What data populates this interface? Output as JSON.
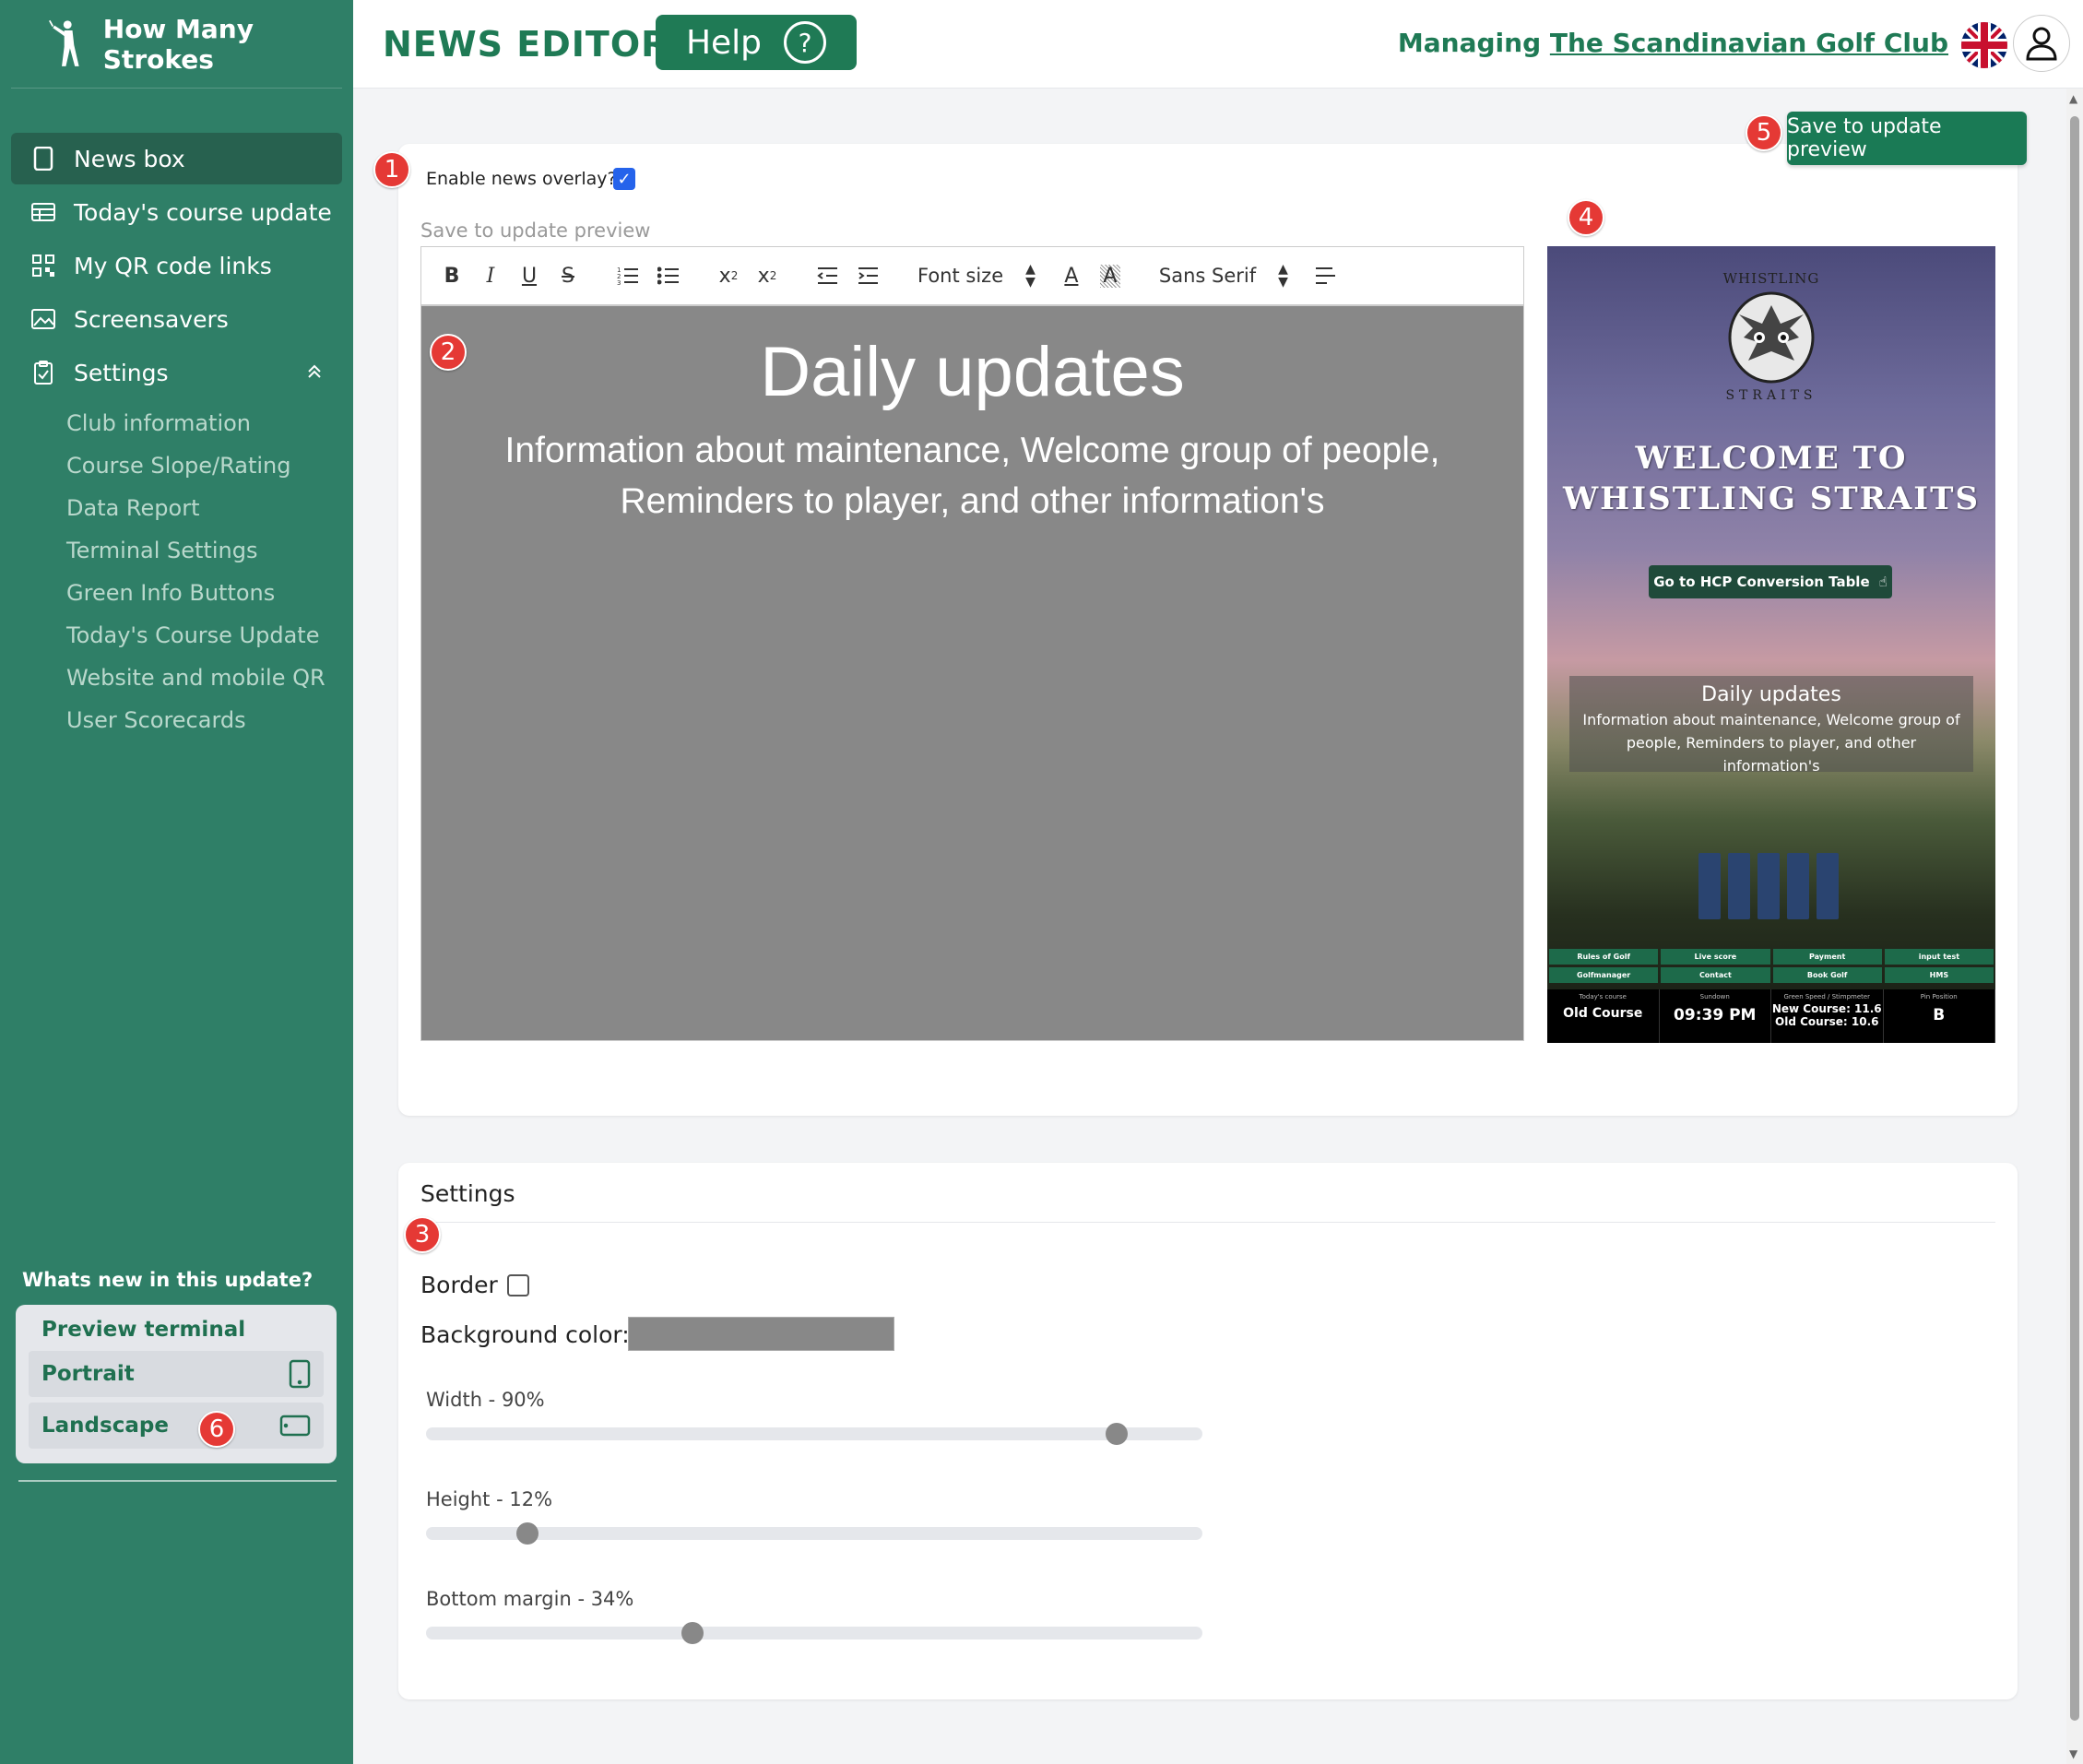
{
  "brand": {
    "name": "How Many Strokes"
  },
  "header": {
    "title": "NEWS EDITOR",
    "help_label": "Help",
    "managing_prefix": "Managing",
    "club_name": "The Scandinavian Golf Club"
  },
  "sidebar": {
    "items": [
      {
        "label": "News box",
        "icon": "tablet-icon"
      },
      {
        "label": "Today's course update",
        "icon": "table-icon"
      },
      {
        "label": "My QR code links",
        "icon": "qr-icon"
      },
      {
        "label": "Screensavers",
        "icon": "image-icon"
      },
      {
        "label": "Settings",
        "icon": "clipboard-icon"
      }
    ],
    "settings_sub": [
      "Club information",
      "Course Slope/Rating",
      "Data Report",
      "Terminal Settings",
      "Green Info Buttons",
      "Today's Course Update",
      "Website and mobile QR",
      "User Scorecards"
    ],
    "whats_new": "Whats new in this update?",
    "preview_title": "Preview terminal",
    "preview_portrait": "Portrait",
    "preview_landscape": "Landscape"
  },
  "badges": [
    "1",
    "2",
    "3",
    "4",
    "5",
    "6"
  ],
  "editor": {
    "enable_label": "Enable news overlay?",
    "enable_checked": true,
    "hint": "Save to update preview",
    "save_button": "Save to update preview",
    "toolbar": {
      "font_size": "Font size",
      "font_family": "Sans Serif"
    },
    "content_title": "Daily updates",
    "content_body": "Information about maintenance, Welcome group of people, Reminders to player, and other information's",
    "background_color": "#888888"
  },
  "preview": {
    "brand_top": "WHISTLING",
    "brand_bottom": "STRAITS",
    "welcome_line1": "WELCOME TO",
    "welcome_line2": "WHISTLING STRAITS",
    "hcp_button": "Go to HCP Conversion Table",
    "news_title": "Daily updates",
    "news_body": "Information about maintenance, Welcome group of people, Reminders to player, and other information's",
    "buttons": [
      "Rules of Golf",
      "Live score",
      "Payment",
      "input test",
      "Golfmanager",
      "Contact",
      "Book Golf",
      "HMS"
    ],
    "info": {
      "course_label": "Today's course",
      "course_value": "Old Course",
      "sundown_label": "Sundown",
      "sundown_value": "09:39 PM",
      "green_label": "Green Speed / Stimpmeter",
      "green_new": "New Course: 11.6",
      "green_old": "Old Course: 10.6",
      "pin_label": "Pin Position",
      "pin_value": "B"
    }
  },
  "settings": {
    "title": "Settings",
    "border_label": "Border",
    "border_checked": false,
    "bg_label": "Background color:",
    "sliders": [
      {
        "label": "Width - 90%",
        "value": 90
      },
      {
        "label": "Height - 12%",
        "value": 12
      },
      {
        "label": "Bottom margin - 34%",
        "value": 34
      }
    ]
  },
  "colors": {
    "sidebar": "#2f7f67",
    "accent": "#1f7a55",
    "badge": "#e53935",
    "checkbox": "#2563eb"
  }
}
